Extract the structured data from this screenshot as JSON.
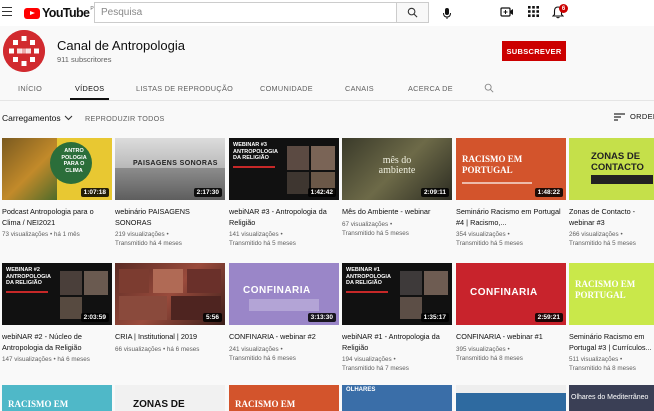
{
  "header": {
    "logo_text": "YouTube",
    "logo_country": "PT",
    "search_placeholder": "Pesquisa",
    "notifications_count": "6"
  },
  "channel": {
    "name": "Canal de Antropologia",
    "subscribers": "911 subscritores",
    "subscribe_label": "SUBSCREVER"
  },
  "tabs": [
    "INÍCIO",
    "VÍDEOS",
    "LISTAS DE REPRODUÇÃO",
    "COMUNIDADE",
    "CANAIS",
    "ACERCA DE"
  ],
  "controls": {
    "uploads_label": "Carregamentos",
    "play_all": "REPRODUZIR TODOS",
    "order_label": "ORDEN"
  },
  "videos": [
    {
      "title": "Podcast Antropologia para o Clima / NEI2021",
      "meta1": "73 visualizações • há 1 mês",
      "meta2": "",
      "duration": "1:07:18",
      "thumb_text": "ANTRO POLOGIA PARA O CLIMA"
    },
    {
      "title": "webinário PAISAGENS SONORAS",
      "meta1": "219 visualizações •",
      "meta2": "Transmitido há 4 meses",
      "duration": "2:17:30",
      "thumb_text": "PAISAGENS SONORAS"
    },
    {
      "title": "webiNAR #3 - Antropologia da Religião",
      "meta1": "141 visualizações •",
      "meta2": "Transmitido há 5 meses",
      "duration": "1:42:42",
      "thumb_text": "WEBINAR #3 ANTROPOLOGIA DA RELIGIÃO"
    },
    {
      "title": "Mês do Ambiente - webinar",
      "meta1": "67 visualizações •",
      "meta2": "Transmitido há 5 meses",
      "duration": "2:09:11",
      "thumb_text": "mês do ambiente"
    },
    {
      "title": "Seminário Racismo em Portugal #4 | Racismo,...",
      "meta1": "354 visualizações •",
      "meta2": "Transmitido há 5 meses",
      "duration": "1:48:22",
      "thumb_text": "RACISMO EM PORTUGAL"
    },
    {
      "title": "Zonas de Contacto - webinar #3",
      "meta1": "266 visualizações •",
      "meta2": "Transmitido há 5 meses",
      "duration": "",
      "thumb_text": "ZONAS DE CONTACTO"
    },
    {
      "title": "webiNAR #2 - Núcleo de Antropologia da Religião",
      "meta1": "147 visualizações • há 6 meses",
      "meta2": "",
      "duration": "2:03:59",
      "thumb_text": "WEBINAR #2 ANTROPOLOGIA DA RELIGIÃO"
    },
    {
      "title": "CRIA | Institutional | 2019",
      "meta1": "66 visualizações • há 6 meses",
      "meta2": "",
      "duration": "5:56",
      "thumb_text": ""
    },
    {
      "title": "CONFINARIA - webinar #2",
      "meta1": "241 visualizações •",
      "meta2": "Transmitido há 6 meses",
      "duration": "3:13:30",
      "thumb_text": "CONFINARIA"
    },
    {
      "title": "webiNAR #1 - Antropologia da Religião",
      "meta1": "194 visualizações •",
      "meta2": "Transmitido há 7 meses",
      "duration": "1:35:17",
      "thumb_text": "WEBINAR #1 ANTROPOLOGIA DA RELIGIÃO"
    },
    {
      "title": "CONFINARIA - webinar #1",
      "meta1": "395 visualizações •",
      "meta2": "Transmitido há 8 meses",
      "duration": "2:59:21",
      "thumb_text": "CONFINARIA"
    },
    {
      "title": "Seminário Racismo em Portugal #3 | Currículos...",
      "meta1": "511 visualizações •",
      "meta2": "Transmitido há 8 meses",
      "duration": "",
      "thumb_text": "RACISMO EM PORTUGAL"
    }
  ],
  "row3_thumbs": [
    "RACISMO EM",
    "ZONAS DE",
    "RACISMO EM",
    "OLHARES",
    "Olhares do Mediterrâneo"
  ]
}
